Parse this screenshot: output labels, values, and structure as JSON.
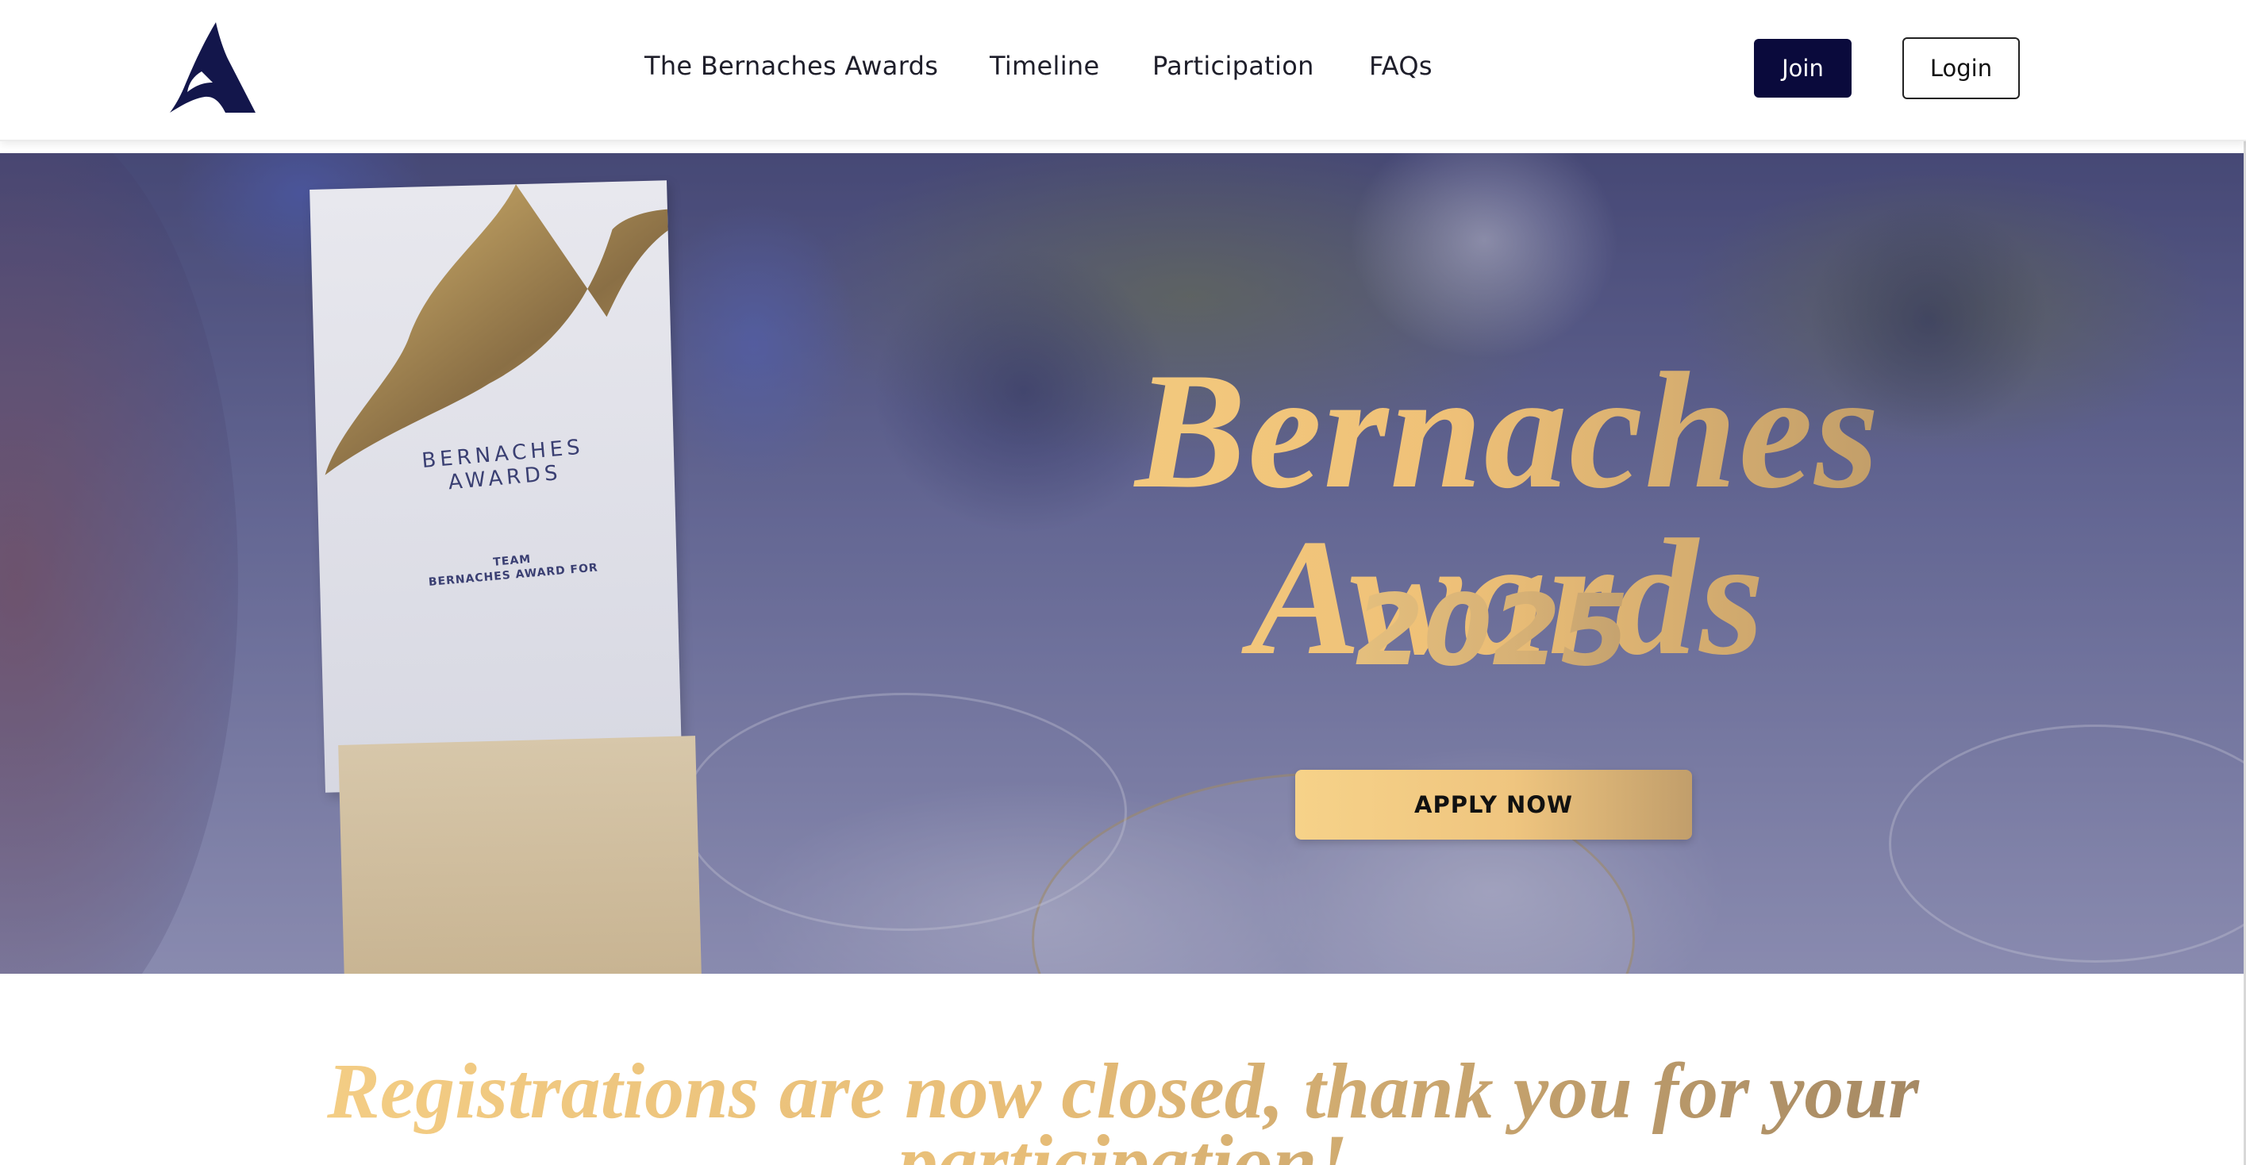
{
  "header": {
    "logo_icon": "bird-logo-icon",
    "nav": [
      {
        "label": "The Bernaches Awards"
      },
      {
        "label": "Timeline"
      },
      {
        "label": "Participation"
      },
      {
        "label": "FAQs"
      }
    ],
    "join_label": "Join",
    "login_label": "Login"
  },
  "hero": {
    "title": "Bernaches Awards",
    "year": "2025",
    "cta_label": "APPLY NOW",
    "trophy": {
      "line1": "BERNACHES",
      "line2": "AWARDS",
      "line3": "TEAM",
      "line4": "BERNACHES AWARD FOR"
    }
  },
  "notice": {
    "text": "Registrations are now closed, thank you for your participation!"
  },
  "colors": {
    "brand_navy": "#0a0a3c",
    "gold_light": "#f6cf82",
    "gold_dark": "#a88a61"
  }
}
